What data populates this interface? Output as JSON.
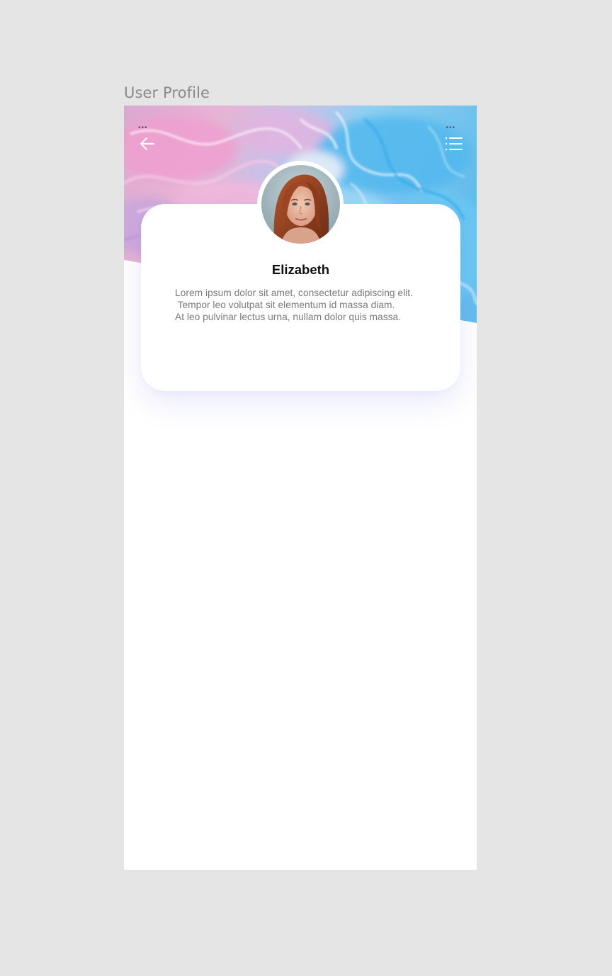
{
  "frame": {
    "label": "User Profile"
  },
  "status_bar": {
    "left_dots": "•••",
    "right_dots": "•••"
  },
  "header": {
    "back_icon": "arrow-left-icon",
    "menu_icon": "list-menu-icon",
    "cover_image": "pink-blue-marble-texture"
  },
  "profile": {
    "avatar": "portrait-photo-red-haired-woman",
    "name": "Elizabeth",
    "bio_lines": [
      "Lorem ipsum dolor sit amet, consectetur adipiscing elit.",
      " Tempor leo volutpat sit elementum id massa diam.",
      "At leo pulvinar lectus urna, nullam dolor quis massa."
    ]
  },
  "colors": {
    "background": "#e5e5e5",
    "surface": "#ffffff",
    "marble_pink": "#e9a7cf",
    "marble_blue": "#6cc4f0",
    "name_text": "#111111",
    "bio_text": "#7b7b7b"
  }
}
